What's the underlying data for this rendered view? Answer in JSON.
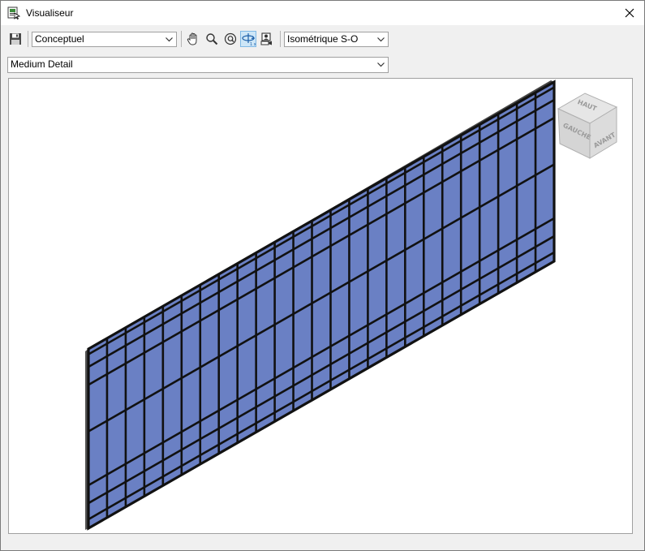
{
  "window": {
    "title": "Visualiseur"
  },
  "toolbar": {
    "visual_style": "Conceptuel",
    "view_orientation": "Isométrique S-O"
  },
  "detail": {
    "level": "Medium Detail"
  },
  "viewcube": {
    "top": "HAUT",
    "left": "GAUCHE",
    "front": "AVANT"
  },
  "colors": {
    "panel_fill": "#6a80c4",
    "mullion": "#111111",
    "active_tool": "#cde6f7"
  },
  "icons": [
    "app-viewer-icon",
    "close-icon",
    "save-icon",
    "pan-icon",
    "zoom-icon",
    "zoom-fit-icon",
    "orbit-icon",
    "camera-icon",
    "chevron-down-icon"
  ]
}
